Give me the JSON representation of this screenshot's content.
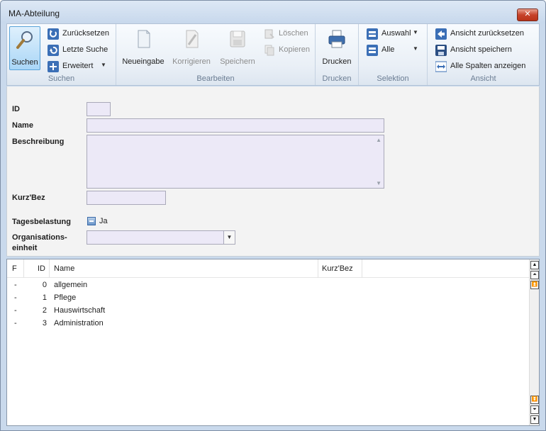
{
  "window": {
    "title": "MA-Abteilung",
    "close_label": "✕"
  },
  "ribbon": {
    "suchen": {
      "label": "Suchen",
      "search_button": "Suchen",
      "reset": "Zurücksetzen",
      "last_search": "Letzte Suche",
      "extended": "Erweitert"
    },
    "bearbeiten": {
      "label": "Bearbeiten",
      "new": "Neueingabe",
      "correct": "Korrigieren",
      "save": "Speichern",
      "delete": "Löschen",
      "copy": "Kopieren"
    },
    "drucken": {
      "label": "Drucken",
      "print": "Drucken"
    },
    "selektion": {
      "label": "Selektion",
      "selection": "Auswahl",
      "all": "Alle"
    },
    "ansicht": {
      "label": "Ansicht",
      "reset_view": "Ansicht zurücksetzen",
      "save_view": "Ansicht speichern",
      "show_all_columns": "Alle Spalten anzeigen"
    }
  },
  "form": {
    "id_label": "ID",
    "id_value": "",
    "name_label": "Name",
    "name_value": "",
    "description_label": "Beschreibung",
    "description_value": "",
    "short_label": "Kurz'Bez",
    "short_value": "",
    "daily_load_label": "Tagesbelastung",
    "daily_load_option": "Ja",
    "org_unit_label_1": "Organisations-",
    "org_unit_label_2": "einheit",
    "org_unit_value": ""
  },
  "grid": {
    "columns": [
      "F",
      "ID",
      "Name",
      "Kurz'Bez"
    ],
    "rows": [
      {
        "f": "-",
        "id": "0",
        "name": "allgemein",
        "short": ""
      },
      {
        "f": "-",
        "id": "1",
        "name": "Pflege",
        "short": ""
      },
      {
        "f": "-",
        "id": "2",
        "name": "Hauswirtschaft",
        "short": ""
      },
      {
        "f": "-",
        "id": "3",
        "name": "Administration",
        "short": ""
      }
    ]
  }
}
